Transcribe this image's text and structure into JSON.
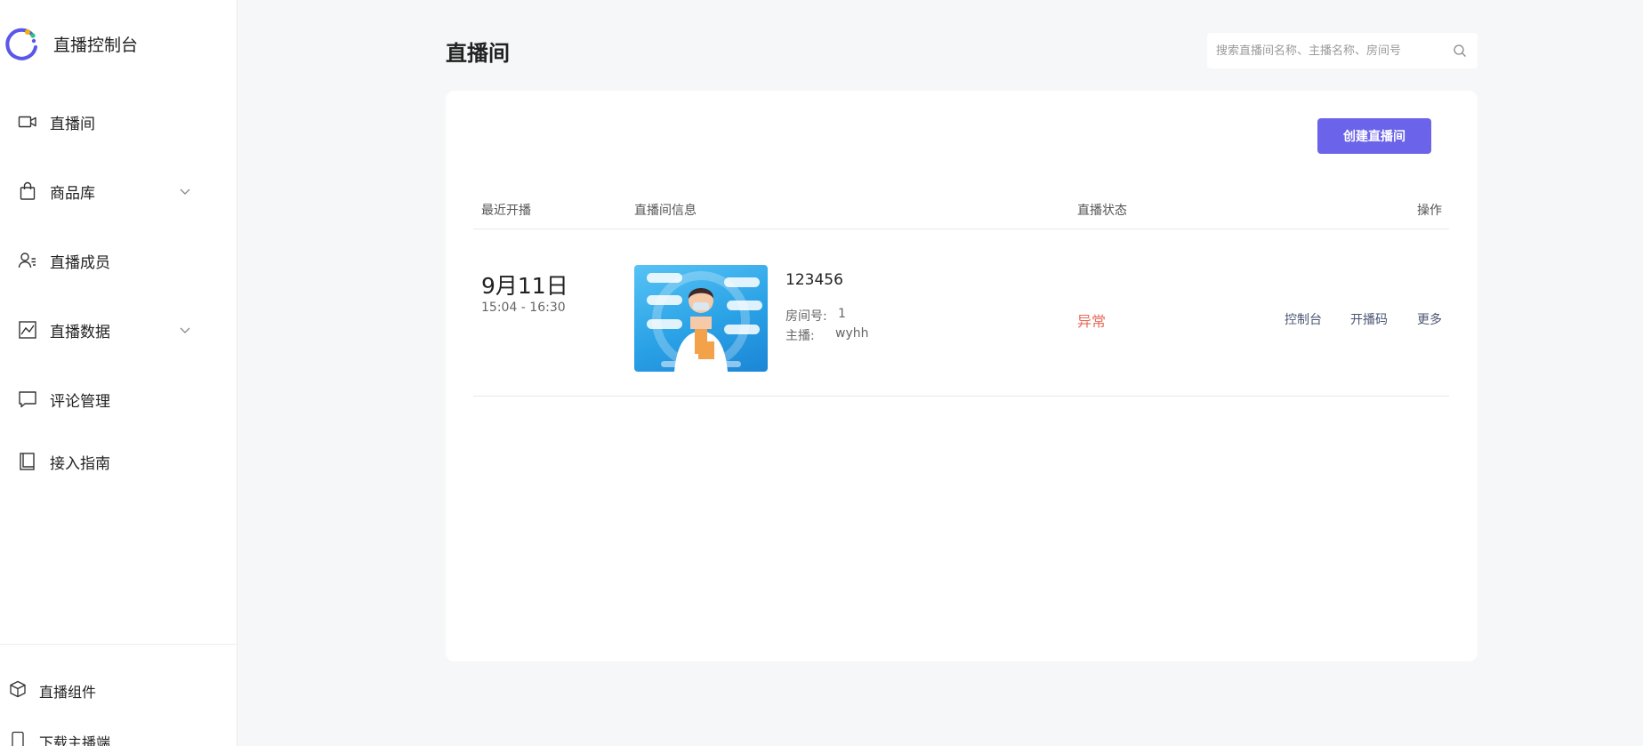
{
  "sidebar": {
    "brand_title": "直播控制台",
    "items": [
      {
        "label": "直播间",
        "icon": "video-camera-icon"
      },
      {
        "label": "商品库",
        "icon": "shopping-bag-icon",
        "has_chevron": true
      },
      {
        "label": "直播成员",
        "icon": "user-list-icon"
      },
      {
        "label": "直播数据",
        "icon": "chart-icon",
        "has_chevron": true
      },
      {
        "label": "评论管理",
        "icon": "comment-icon"
      },
      {
        "label": "接入指南",
        "icon": "book-icon"
      }
    ],
    "footer": [
      {
        "label": "直播组件",
        "icon": "cube-icon"
      },
      {
        "label": "下载主播端",
        "icon": "phone-icon"
      }
    ]
  },
  "header": {
    "title": "直播间",
    "search_placeholder": "搜索直播间名称、主播名称、房间号"
  },
  "toolbar": {
    "create_label": "创建直播间"
  },
  "table": {
    "columns": [
      "最近开播",
      "直播间信息",
      "直播状态",
      "操作"
    ],
    "rows": [
      {
        "date": "9月11日",
        "time": "15:04 - 16:30",
        "room_name": "123456",
        "room_no_label": "房间号:",
        "room_no": "1",
        "host_label": "主播:",
        "host": "wyhh",
        "status": "异常",
        "actions": [
          "控制台",
          "开播码",
          "更多"
        ]
      }
    ]
  },
  "colors": {
    "accent": "#6b63e9",
    "status_error": "#e96a5b",
    "action_link": "#4a5672",
    "page_bg": "#f6f7f8"
  }
}
